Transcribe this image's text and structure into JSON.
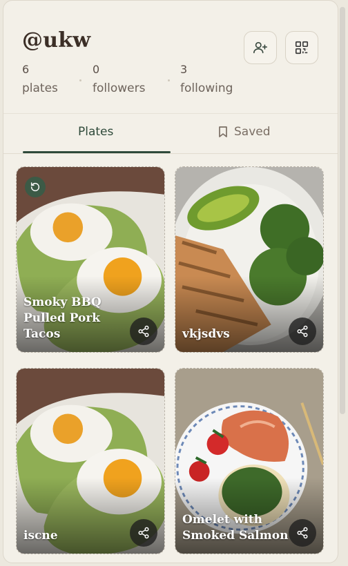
{
  "profile": {
    "handle": "@ukw",
    "stats": [
      {
        "value": "6",
        "label": "plates"
      },
      {
        "value": "0",
        "label": "followers"
      },
      {
        "value": "3",
        "label": "following"
      }
    ],
    "actions": {
      "add_friend_icon": "user-plus-icon",
      "qr_icon": "qr-code-icon"
    }
  },
  "tabs": [
    {
      "label": "Plates",
      "active": true
    },
    {
      "label": "Saved",
      "icon": "bookmark-icon",
      "active": false
    }
  ],
  "plates": [
    {
      "title": "Smoky BBQ Pulled Pork Tacos",
      "image": "avocado-toast-eggs",
      "badge_icon": "repeat-icon"
    },
    {
      "title": "vkjsdvs",
      "image": "chicken-broccoli-bowl"
    },
    {
      "title": "iscne",
      "image": "avocado-toast-eggs"
    },
    {
      "title": "Omelet with Smoked Salmon",
      "image": "salmon-plate"
    }
  ],
  "colors": {
    "accent": "#2f4a3a",
    "background": "#f3f0e8",
    "text": "#3b2e26"
  }
}
